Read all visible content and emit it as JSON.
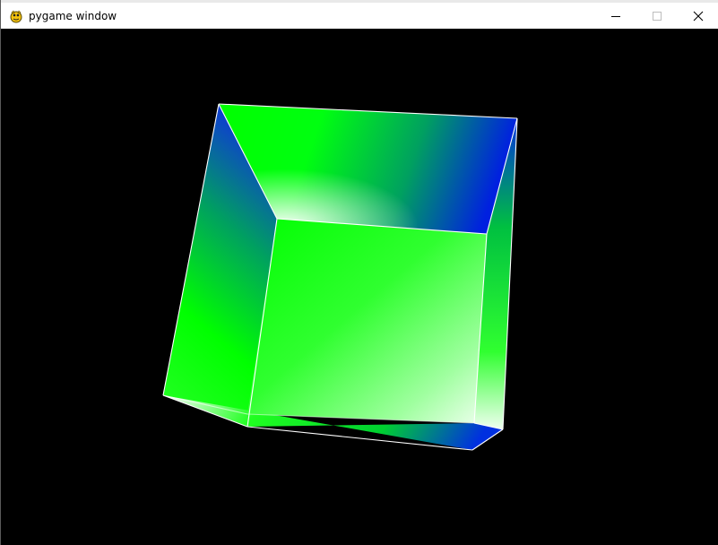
{
  "window": {
    "title": "pygame window",
    "app_icon": "pygame-snake-icon",
    "controls": {
      "minimize_icon": "minimize-icon",
      "maximize_icon": "maximize-icon",
      "close_icon": "close-icon"
    }
  },
  "scene": {
    "background_color": "#000000",
    "edge_color": "#ffffff",
    "colors": {
      "green": "#00ff00",
      "blue": "#0022dd",
      "white": "#ffffff"
    }
  }
}
